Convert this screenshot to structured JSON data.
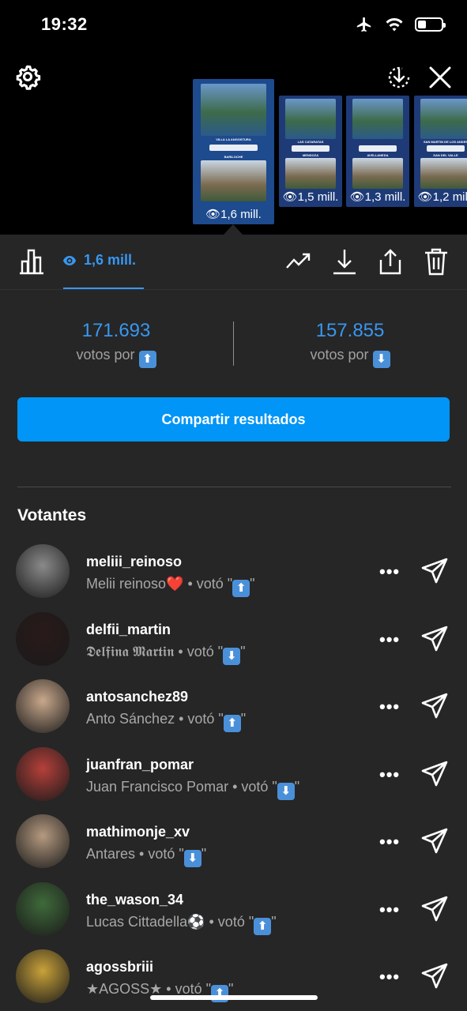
{
  "status_bar": {
    "time": "19:32",
    "battery_level": 0.35
  },
  "story_thumbs": [
    {
      "views": "1,6 mill.",
      "label_top": "VILLA LA ANGOSTURA",
      "label_bottom": "BARILOCHE",
      "selected": true
    },
    {
      "views": "1,5 mill.",
      "label_top": "LAS CATARATAS",
      "label_bottom": "MENDOZA",
      "selected": false
    },
    {
      "views": "1,3 mill.",
      "label_top": "",
      "label_bottom": "AVELLANEDA",
      "selected": false
    },
    {
      "views": "1,2 mill.",
      "label_top": "SAN MARTIN DE LOS ANDES",
      "label_bottom": "SAN DEL VALLE",
      "selected": false
    }
  ],
  "toolbar": {
    "views_label": "1,6 mill."
  },
  "votes": {
    "up_count": "171.693",
    "up_label": "votos por",
    "down_count": "157.855",
    "down_label": "votos por",
    "up_emoji": "⬆",
    "down_emoji": "⬇"
  },
  "share_button": "Compartir resultados",
  "voters_title": "Votantes",
  "voters": [
    {
      "username": "meliii_reinoso",
      "name": "Melii reinoso",
      "suffix": "❤️",
      "voted_text": " • votó \"",
      "vote": "⬆",
      "close": "\"",
      "avatar_color": "#8a8a8a"
    },
    {
      "username": "delfii_martin",
      "name": "𝕯𝖊𝖑𝖋𝖎𝖓𝖆 𝕸𝖆𝖗𝖙𝖎𝖓",
      "suffix": "",
      "voted_text": " • votó \"",
      "vote": "⬇",
      "close": "\"",
      "avatar_color": "#2a1a1a"
    },
    {
      "username": "antosanchez89",
      "name": "Anto Sánchez",
      "suffix": "",
      "voted_text": " • votó \"",
      "vote": "⬆",
      "close": "\"",
      "avatar_color": "#c9a88c"
    },
    {
      "username": "juanfran_pomar",
      "name": "Juan Francisco Pomar",
      "suffix": "",
      "voted_text": " • votó \"",
      "vote": "⬇",
      "close": "\"",
      "avatar_color": "#b5403a"
    },
    {
      "username": "mathimonje_xv",
      "name": "Antares",
      "suffix": "",
      "voted_text": " • votó \"",
      "vote": "⬇",
      "close": "\"",
      "avatar_color": "#b59a80"
    },
    {
      "username": "the_wason_34",
      "name": "Lucas Cittadella",
      "suffix": "⚽",
      "voted_text": " • votó \"",
      "vote": "⬆",
      "close": "\"",
      "avatar_color": "#3f6a3a"
    },
    {
      "username": "agossbriii",
      "name": "★AGOSS★",
      "suffix": "",
      "voted_text": " • votó \"",
      "vote": "⬆",
      "close": "\"",
      "avatar_color": "#c9a23a"
    }
  ]
}
